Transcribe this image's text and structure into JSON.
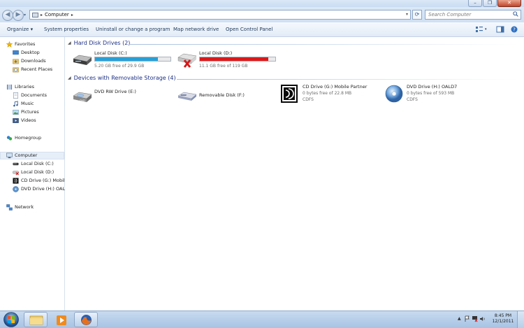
{
  "address": {
    "path": [
      "Computer"
    ],
    "search_placeholder": "Search Computer"
  },
  "toolbar": {
    "items": [
      "Organize ▾",
      "System properties",
      "Uninstall or change a program",
      "Map network drive",
      "Open Control Panel"
    ]
  },
  "nav": {
    "favorites": "Favorites",
    "favorites_items": [
      "Desktop",
      "Downloads",
      "Recent Places"
    ],
    "libraries": "Libraries",
    "libraries_items": [
      "Documents",
      "Music",
      "Pictures",
      "Videos"
    ],
    "homegroup": "Homegroup",
    "computer": "Computer",
    "computer_items": [
      "Local Disk (C:)",
      "Local Disk (D:)",
      "CD Drive (G:) Mobile",
      "DVD Drive (H:) OALD"
    ],
    "network": "Network"
  },
  "groups": {
    "hdd_header": "Hard Disk Drives (2)",
    "removable_header": "Devices with Removable Storage (4)"
  },
  "drives": [
    {
      "name": "Local Disk (C:)",
      "free": "5.20 GB free of 29.9 GB",
      "used_fraction": 0.83,
      "bar_color": "#27a0d8"
    },
    {
      "name": "Local Disk (D:)",
      "free": "11.1 GB free of 119 GB",
      "used_fraction": 0.91,
      "bar_color": "#e01818"
    }
  ],
  "removable": [
    {
      "name": "DVD RW Drive (E:)"
    },
    {
      "name": "Removable Disk (F:)"
    },
    {
      "name": "CD Drive (G:) Mobile Partner",
      "free": "0 bytes free of 22.8 MB",
      "fs": "CDFS"
    },
    {
      "name": "DVD Drive (H:) OALD7",
      "free": "0 bytes free of 593 MB",
      "fs": "CDFS"
    }
  ],
  "taskbar": {
    "time": "8:45 PM",
    "date": "12/1/2011"
  },
  "colors": {
    "header": "#1e3287",
    "c_bar": "#27a0d8",
    "d_bar": "#e01818"
  }
}
